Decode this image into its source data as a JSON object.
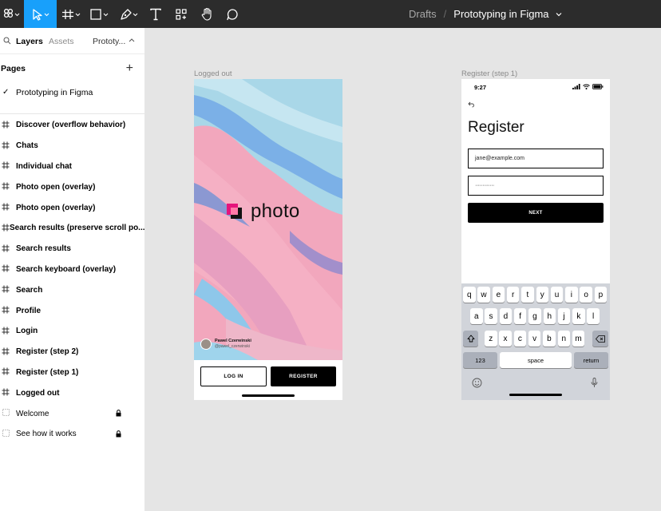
{
  "toolbar": {
    "icons": [
      "figma-menu-icon",
      "move-tool-icon",
      "frame-tool-icon",
      "shape-tool-icon",
      "pen-tool-icon",
      "text-tool-icon",
      "components-icon",
      "hand-tool-icon",
      "comment-icon"
    ],
    "breadcrumb_parent": "Drafts",
    "breadcrumb_separator": "/",
    "file_name": "Prototyping in Figma",
    "active_color": "#18a0fb",
    "bg_color": "#2c2c2c"
  },
  "sidebar": {
    "tabs": [
      "Layers",
      "Assets",
      "Prototy..."
    ],
    "pages_heading": "Pages",
    "add_label": "+",
    "current_page": "Prototyping in Figma",
    "layers": [
      {
        "name": "Discover (overflow behavior)",
        "type": "frame"
      },
      {
        "name": "Chats",
        "type": "frame"
      },
      {
        "name": "Individual chat",
        "type": "frame"
      },
      {
        "name": "Photo open (overlay)",
        "type": "frame"
      },
      {
        "name": "Photo open (overlay)",
        "type": "frame"
      },
      {
        "name": "Search results (preserve scroll po...",
        "type": "frame"
      },
      {
        "name": "Search results",
        "type": "frame"
      },
      {
        "name": "Search keyboard (overlay)",
        "type": "frame"
      },
      {
        "name": "Search",
        "type": "frame"
      },
      {
        "name": "Profile",
        "type": "frame"
      },
      {
        "name": "Login",
        "type": "frame"
      },
      {
        "name": "Register (step 2)",
        "type": "frame"
      },
      {
        "name": "Register (step 1)",
        "type": "frame"
      },
      {
        "name": "Logged out",
        "type": "frame"
      },
      {
        "name": "Welcome",
        "type": "section",
        "locked": true
      },
      {
        "name": "See how it works",
        "type": "section",
        "locked": true
      }
    ]
  },
  "canvas": {
    "frame1": {
      "label": "Logged out",
      "logo_text": "photo",
      "credit_name": "Pawel Czerwinski",
      "credit_handle": "@pawel_czerwinski",
      "login_label": "LOG IN",
      "register_label": "REGISTER"
    },
    "frame2": {
      "label": "Register (step 1)",
      "time": "9:27",
      "title": "Register",
      "email_value": "jane@example.com",
      "password_value": "·············",
      "next_label": "NEXT",
      "keyboard": {
        "row1": [
          "q",
          "w",
          "e",
          "r",
          "t",
          "y",
          "u",
          "i",
          "o",
          "p"
        ],
        "row2": [
          "a",
          "s",
          "d",
          "f",
          "g",
          "h",
          "j",
          "k",
          "l"
        ],
        "row3": [
          "z",
          "x",
          "c",
          "v",
          "b",
          "n",
          "m"
        ],
        "num_label": "123",
        "space_label": "space",
        "return_label": "return"
      }
    }
  }
}
